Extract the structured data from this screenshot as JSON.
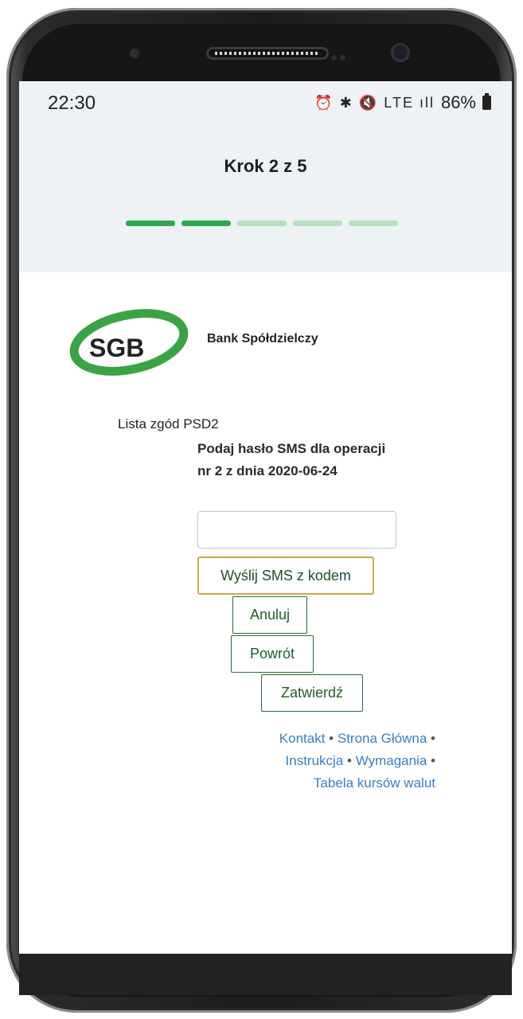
{
  "status_bar": {
    "time": "22:30",
    "icons": "⏰ ✱ 🔇 LTE ıll",
    "battery": "86%"
  },
  "header": {
    "step_title": "Krok 2 z 5",
    "progress": {
      "current_step": 2,
      "total_steps": 5
    }
  },
  "logo": {
    "monogram": "SGB",
    "brand_name": "Bank Spółdzielczy",
    "color": "#3aa346"
  },
  "content": {
    "consent_list_title": "Lista zgód PSD2",
    "prompt": "Podaj hasło SMS dla operacji nr 2 z dnia 2020-06-24",
    "sms_input_value": ""
  },
  "buttons": {
    "send_sms": "Wyślij SMS z kodem",
    "cancel": "Anuluj",
    "back": "Powrót",
    "confirm": "Zatwierdź"
  },
  "footer": {
    "links": [
      "Kontakt",
      "Strona Główna",
      "Instrukcja",
      "Wymagania",
      "Tabela kursów walut"
    ],
    "separator": "•"
  },
  "colors": {
    "accent_green": "#2fa84f",
    "button_text": "#1f5d2a",
    "link": "#3a7fc0",
    "highlight_border": "#c9a94a"
  }
}
